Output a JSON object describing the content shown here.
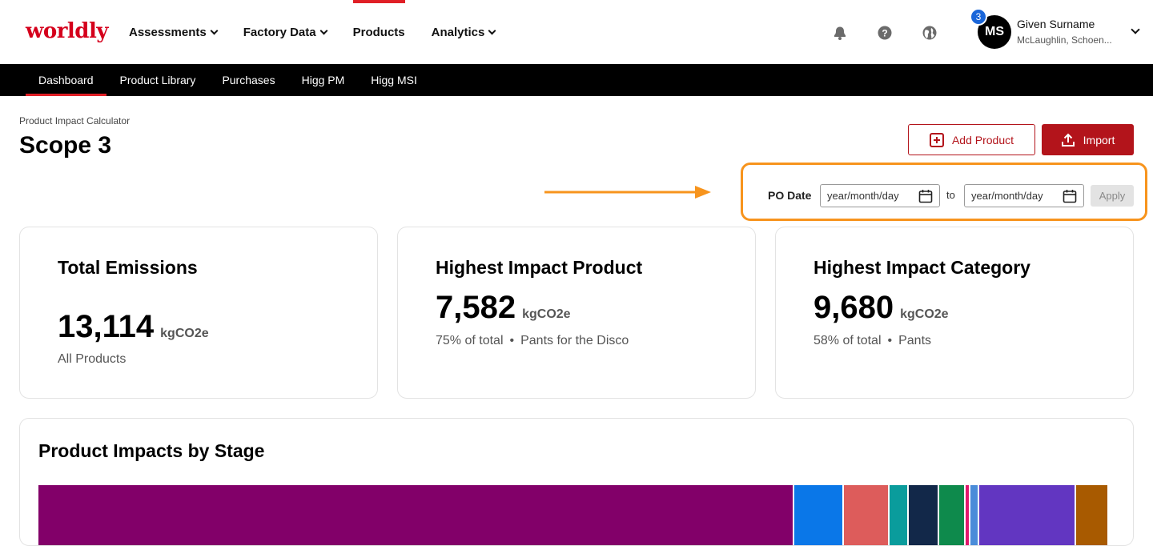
{
  "header": {
    "logo": "worldly",
    "nav": [
      {
        "label": "Assessments",
        "dropdown": true,
        "active": false
      },
      {
        "label": "Factory Data",
        "dropdown": true,
        "active": false
      },
      {
        "label": "Products",
        "dropdown": false,
        "active": true
      },
      {
        "label": "Analytics",
        "dropdown": true,
        "active": false
      }
    ],
    "icons": [
      "notification-bell-icon",
      "help-icon",
      "globe-icon"
    ],
    "user": {
      "initials": "MS",
      "notification_count": "3",
      "name": "Given Surname",
      "org": "McLaughlin, Schoen..."
    }
  },
  "subnav": [
    {
      "label": "Dashboard",
      "active": true
    },
    {
      "label": "Product Library",
      "active": false
    },
    {
      "label": "Purchases",
      "active": false
    },
    {
      "label": "Higg PM",
      "active": false
    },
    {
      "label": "Higg MSI",
      "active": false
    }
  ],
  "page": {
    "breadcrumb": "Product Impact Calculator",
    "title": "Scope 3",
    "add_product_label": "Add Product",
    "import_label": "Import"
  },
  "filter": {
    "label": "PO Date",
    "from_placeholder": "year/month/day",
    "to_label": "to",
    "to_placeholder": "year/month/day",
    "apply_label": "Apply"
  },
  "cards": [
    {
      "title": "Total Emissions",
      "value": "13,114",
      "unit": "kgCO2e",
      "sub_a": "All Products",
      "sub_b": ""
    },
    {
      "title": "Highest Impact Product",
      "value": "7,582",
      "unit": "kgCO2e",
      "sub_a": "75% of total",
      "sub_b": "Pants for the Disco"
    },
    {
      "title": "Highest Impact Category",
      "value": "9,680",
      "unit": "kgCO2e",
      "sub_a": "58% of total",
      "sub_b": "Pants"
    }
  ],
  "stage": {
    "title": "Product Impacts by Stage",
    "segments": [
      {
        "color": "#820069",
        "share": 0.7015
      },
      {
        "color": "#0a77e8",
        "share": 0.0467
      },
      {
        "color": "#dd5c5b",
        "share": 0.0423
      },
      {
        "color": "#0a9c9c",
        "share": 0.0178
      },
      {
        "color": "#122849",
        "share": 0.0282
      },
      {
        "color": "#0e8a4c",
        "share": 0.0245
      },
      {
        "color": "#e0186c",
        "share": 0.0045
      },
      {
        "color": "#4a8cd9",
        "share": 0.0082
      },
      {
        "color": "#6236c1",
        "share": 0.0898
      },
      {
        "color": "#a85a00",
        "share": 0.0304
      }
    ]
  },
  "colors": {
    "brand_red": "#b3141b",
    "nav_accent": "#e01f26",
    "annotation_orange": "#f7941d"
  }
}
